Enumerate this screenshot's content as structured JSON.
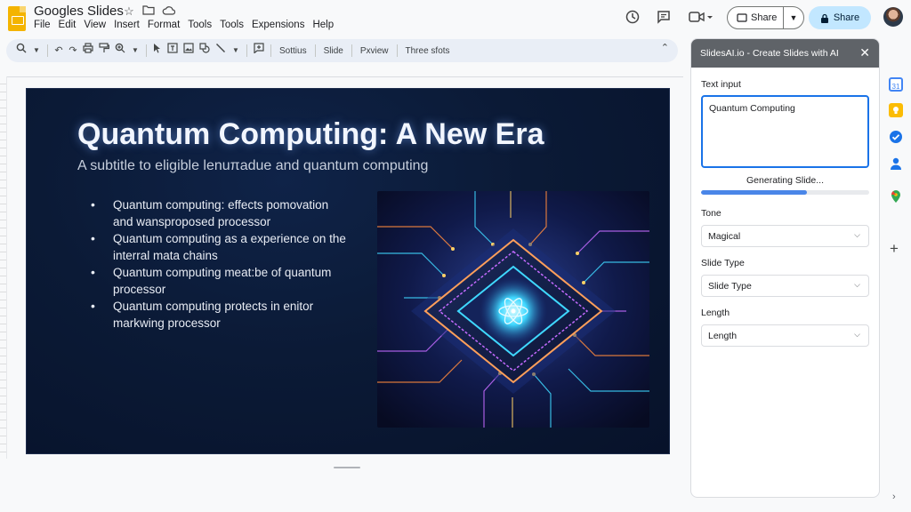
{
  "app": {
    "title": "Googles Slides"
  },
  "menu": [
    "File",
    "Edit",
    "View",
    "Insert",
    "Format",
    "Tools",
    "Tools",
    "Expensions",
    "Help"
  ],
  "header": {
    "share_label": "Share",
    "share_primary_label": "Share"
  },
  "toolbar": {
    "text_items": [
      "Sottius",
      "Slide",
      "Pxview",
      "Three sfots"
    ]
  },
  "slide": {
    "title": "Quantum Computing: A New Era",
    "subtitle": "A subtitle to eligible lenuπadue and quantum computing",
    "bullets": [
      "Quantum computing: effects pomovation and wansproposed processor",
      "Quantum computing as a experience on the interral mata chains",
      "Quantum computing meat:be of quantum processor",
      "Quantum computing protects in enitor markwing processor"
    ]
  },
  "panel": {
    "title": "SlidesAI.io - Create Slides with AI",
    "text_input_label": "Text input",
    "text_input_value": "Quantum Computing",
    "status": "Generating Slide...",
    "progress_fraction": 0.63,
    "tone_label": "Tone",
    "tone_value": "Magical",
    "slide_type_label": "Slide Type",
    "slide_type_value": "Slide Type",
    "length_label": "Length",
    "length_value": "Length"
  },
  "colors": {
    "accent": "#1a73e8",
    "share_primary": "#c2e7ff",
    "progress": "#4a86e8",
    "slide_bg": "#0b1a36"
  },
  "icons": {
    "header": [
      "history-icon",
      "comment-icon",
      "video-call-icon"
    ],
    "rail": [
      "calendar-icon",
      "keep-icon",
      "tasks-icon",
      "contacts-icon",
      "maps-icon"
    ]
  }
}
